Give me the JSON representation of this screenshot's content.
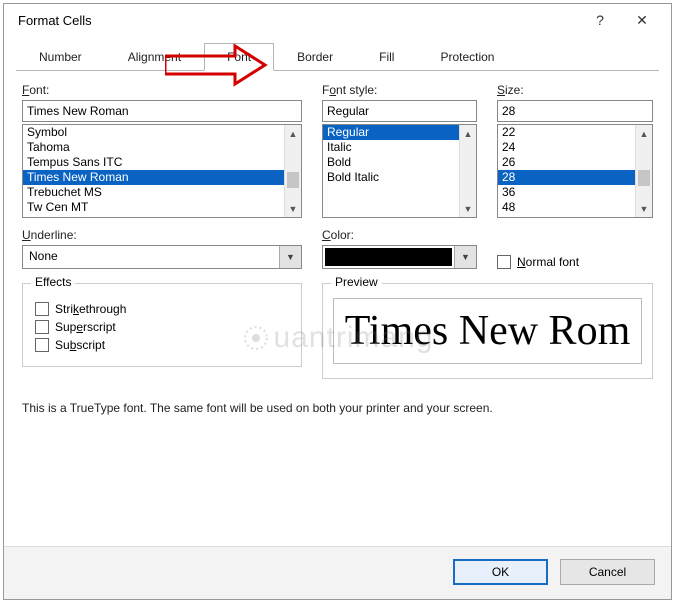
{
  "window": {
    "title": "Format Cells",
    "help": "?",
    "close": "✕"
  },
  "tabs": {
    "number": "Number",
    "alignment": "Alignment",
    "font": "Font",
    "border": "Border",
    "fill": "Fill",
    "protection": "Protection"
  },
  "font": {
    "label": "Font:",
    "value": "Times New Roman",
    "list": [
      "Symbol",
      "Tahoma",
      "Tempus Sans ITC",
      "Times New Roman",
      "Trebuchet MS",
      "Tw Cen MT"
    ],
    "selected": "Times New Roman"
  },
  "fontstyle": {
    "label": "Font style:",
    "value": "Regular",
    "list": [
      "Regular",
      "Italic",
      "Bold",
      "Bold Italic"
    ],
    "selected": "Regular"
  },
  "size": {
    "label": "Size:",
    "value": "28",
    "list": [
      "22",
      "24",
      "26",
      "28",
      "36",
      "48"
    ],
    "selected": "28"
  },
  "underline": {
    "label": "Underline:",
    "value": "None"
  },
  "color": {
    "label": "Color:",
    "value": "#000000"
  },
  "normalfont": {
    "label": "Normal font"
  },
  "effects": {
    "label": "Effects",
    "strikethrough": "Strikethrough",
    "superscript": "Superscript",
    "subscript": "Subscript"
  },
  "preview": {
    "label": "Preview",
    "sample": "Times New Rom"
  },
  "info": "This is a TrueType font.  The same font will be used on both your printer and your screen.",
  "buttons": {
    "ok": "OK",
    "cancel": "Cancel"
  },
  "watermark": "uantrimang"
}
